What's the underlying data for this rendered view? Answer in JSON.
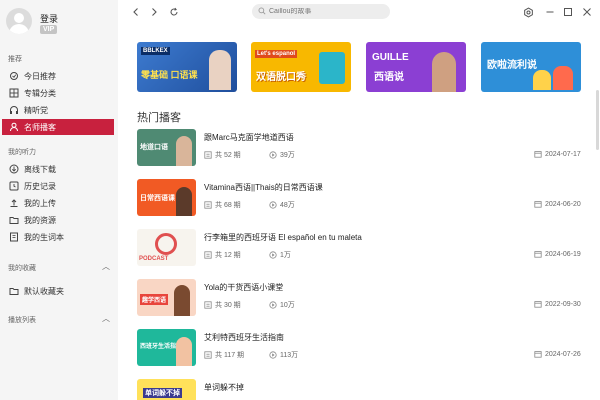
{
  "user": {
    "name": "登录",
    "badge": "VIP"
  },
  "sidebar": {
    "recommend_title": "推荐",
    "recommend_items": [
      {
        "label": "今日推荐",
        "icon": "sun-icon"
      },
      {
        "label": "专辑分类",
        "icon": "grid-icon"
      },
      {
        "label": "精听党",
        "icon": "headphones-icon"
      },
      {
        "label": "名师播客",
        "icon": "person-icon"
      }
    ],
    "listen_title": "我的听力",
    "listen_items": [
      {
        "label": "离线下载",
        "icon": "download-icon"
      },
      {
        "label": "历史记录",
        "icon": "history-icon"
      },
      {
        "label": "我的上传",
        "icon": "upload-icon"
      },
      {
        "label": "我的资源",
        "icon": "folder-icon"
      },
      {
        "label": "我的生词本",
        "icon": "book-icon"
      }
    ],
    "favorites_title": "我的收藏",
    "favorites_items": [
      {
        "label": "默认收藏夹",
        "icon": "folder-icon"
      }
    ],
    "playlist_title": "播放列表"
  },
  "search": {
    "placeholder": "Caillou的故事"
  },
  "banners": [
    {
      "text1": "零基础 口语课",
      "text2": "BBLKEX",
      "color": "#3a6fb8"
    },
    {
      "text1": "双语脱口秀",
      "text2": "Let's espanol",
      "color": "#f6b400"
    },
    {
      "text1": "GUILLE",
      "text2": "西语说",
      "color": "#8a3fd1"
    },
    {
      "text1": "欧啦流利说",
      "text2": "",
      "color": "#2f8fd6"
    }
  ],
  "section_title": "热门播客",
  "podcasts": [
    {
      "title": "跟Marc马克面学地道西语",
      "count": "共 52 期",
      "plays": "39万",
      "date": "2024-07-17",
      "thumb_text": "地道口语"
    },
    {
      "title": "Vitamina西语||Thais的日常西语课",
      "count": "共 68 期",
      "plays": "48万",
      "date": "2024-06-20",
      "thumb_text": "日常西语课"
    },
    {
      "title": "行李箱里的西班牙语 El español en tu maleta",
      "count": "共 12 期",
      "plays": "1万",
      "date": "2024-06-19",
      "thumb_text": "PODCAST"
    },
    {
      "title": "Yola的干货西语小课堂",
      "count": "共 30 期",
      "plays": "10万",
      "date": "2022-09-30",
      "thumb_text": "趣学西语"
    },
    {
      "title": "艾利特西班牙生活指南",
      "count": "共 117 期",
      "plays": "113万",
      "date": "2024-07-26",
      "thumb_text": "西班牙生活指南"
    },
    {
      "title": "单词躲不掉",
      "count": "",
      "plays": "",
      "date": "",
      "thumb_text": "单词躲不掉"
    }
  ]
}
